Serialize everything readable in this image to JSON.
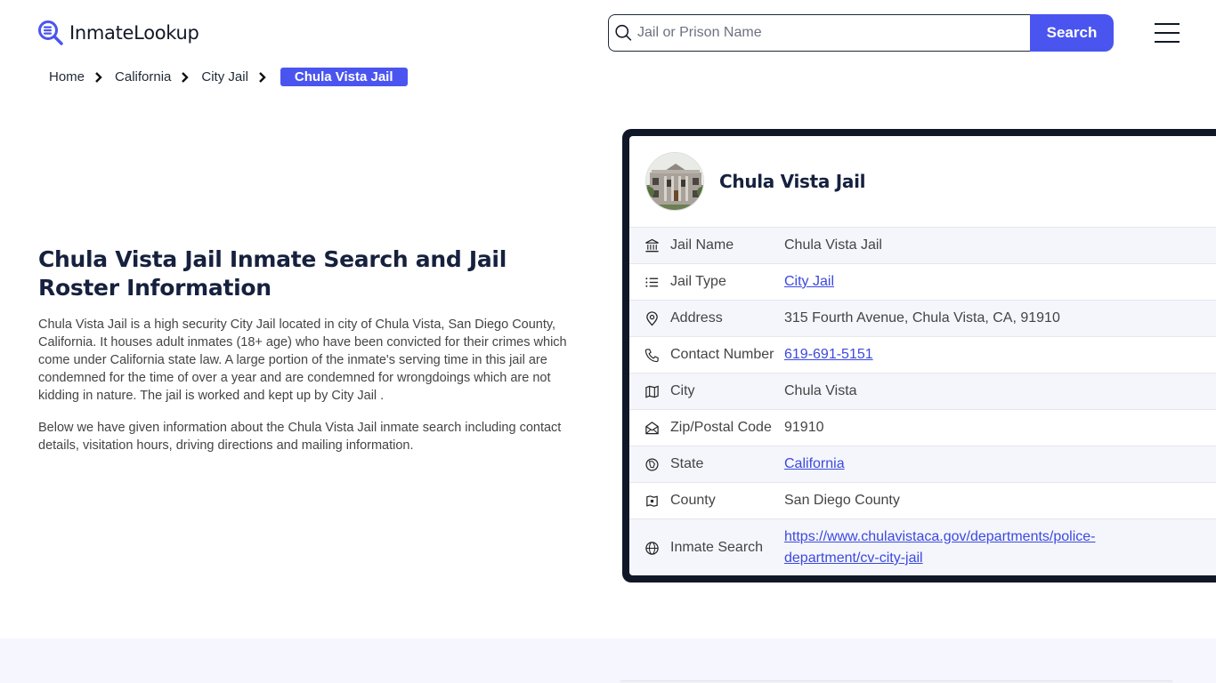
{
  "header": {
    "logo_text": "InmateLookup",
    "search_placeholder": "Jail or Prison Name",
    "search_value": "",
    "search_button": "Search",
    "brand_color": "#4a55f0"
  },
  "breadcrumb": {
    "items": [
      "Home",
      "California",
      "City Jail"
    ],
    "current": "Chula Vista Jail"
  },
  "intro": {
    "title": "Chula Vista Jail Inmate Search and Jail Roster Information",
    "paragraphs": [
      "Chula Vista Jail is a high security City Jail located in city of Chula Vista, San Diego County, California. It houses adult inmates (18+ age) who have been convicted for their crimes which come under California state law. A large portion of the inmate's serving time in this jail are condemned for the time of over a year and are condemned for wrongdoings which are not kidding in nature. The jail is worked and kept up by City Jail .",
      "Below we have given information about the Chula Vista Jail inmate search including contact details, visitation hours, driving directions and mailing information."
    ]
  },
  "card": {
    "title": "Chula Vista Jail",
    "rows": [
      {
        "icon": "building-columns-icon",
        "label": "Jail Name",
        "value": "Chula Vista Jail",
        "link": false
      },
      {
        "icon": "list-icon",
        "label": "Jail Type",
        "value": "City Jail",
        "link": true
      },
      {
        "icon": "map-pin-icon",
        "label": "Address",
        "value": "315 Fourth Avenue, Chula Vista, CA, 91910",
        "link": false
      },
      {
        "icon": "phone-icon",
        "label": "Contact Number",
        "value": "619-691-5151",
        "link": true
      },
      {
        "icon": "map-icon",
        "label": "City",
        "value": "Chula Vista",
        "link": false
      },
      {
        "icon": "mail-open-icon",
        "label": "Zip/Postal Code",
        "value": "91910",
        "link": false
      },
      {
        "icon": "state-badge-icon",
        "label": "State",
        "value": "California",
        "link": true
      },
      {
        "icon": "county-map-icon",
        "label": "County",
        "value": "San Diego County",
        "link": false
      },
      {
        "icon": "globe-icon",
        "label": "Inmate Search",
        "value": "https://www.chulavistaca.gov/departments/police-department/cv-city-jail",
        "link": true
      }
    ]
  }
}
